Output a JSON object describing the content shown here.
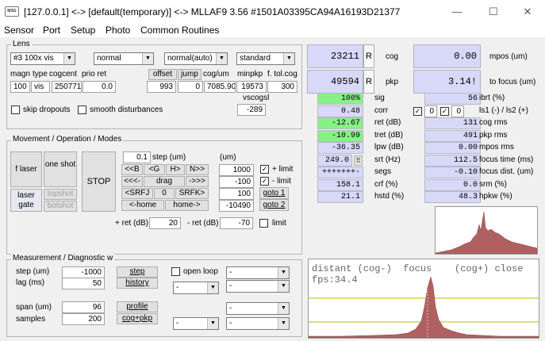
{
  "window": {
    "title": "[127.0.0.1] <-> [default(temporary)] <-> MLLAF9 3.56 #1501A03395CA94A16193D21377",
    "icon": "MSG",
    "minimize": "—",
    "maximize": "☐",
    "close": "✕"
  },
  "menu": [
    "Sensor",
    "Port",
    "Setup",
    "Photo",
    "Common Routines"
  ],
  "lens": {
    "title": "Lens",
    "lens_select": "#3 100x vis",
    "mode_select": "normal",
    "auto_select": "normal(auto)",
    "std_select": "standard",
    "hdr_magn": "magn",
    "hdr_type": "type",
    "hdr_cogcent": "cogcent",
    "hdr_prio": "prio ret",
    "magn": "100",
    "type": "vis",
    "cogcent": "250771",
    "prio": "0.0",
    "offset_btn": "offset",
    "jump_btn": "jump",
    "hdr_coguim": "cog/um",
    "hdr_minpkp": "minpkp",
    "hdr_ftol": "f. tol.cog",
    "offset": "993",
    "jump": "0",
    "coguim": "7085.90",
    "minpkp": "19573",
    "ftol": "300",
    "vscogsl_label": "vscogsl",
    "vscogsl": "-289",
    "skip_dropouts": "skip dropouts",
    "smooth": "smooth disturbances"
  },
  "movement": {
    "title": "Movement / Operation / Modes",
    "laser_btn": "f laser",
    "oneshot_btn": "one shot",
    "laser_gate_btn": "laser gate",
    "topshot_btn": "topshot",
    "botshot_btn": "botshot",
    "stop_btn": "STOP",
    "step_value": "0.1",
    "step_label": "step (um)",
    "um_label": "(um)",
    "b1": "<<B",
    "b2": "<G",
    "b3": "H>",
    "b4": "N>>",
    "b5": "<<<-",
    "b6": "drag",
    "b7": "->>>",
    "b8": "<SRFJ",
    "b9": "0",
    "b10": "SRFK>",
    "b11": "<-home",
    "b12": "home->",
    "plus_limit_val": "1000",
    "plus_limit": "+ limit",
    "minus_limit_val": "-100",
    "minus_limit": "- limit",
    "goto1_val": "100",
    "goto1": "goto 1",
    "goto2_val": "-10490",
    "goto2": "goto 2",
    "pret_label": "+ ret (dB)",
    "pret": "20",
    "mret_label": "- ret (dB)",
    "mret": "-70",
    "limit": "limit"
  },
  "measurement": {
    "title": "Measurement / Diagnostic w",
    "step_label": "step (um)",
    "step": "-1000",
    "lag_label": "lag (ms)",
    "lag": "50",
    "span_label": "span (um)",
    "span": "96",
    "samples_label": "samples",
    "samples": "200",
    "step_btn": "step",
    "history_btn": "history",
    "profile_btn": "profile",
    "cogpkp_btn": "cog+pkp",
    "openloop": "open loop",
    "combo_dash": "-"
  },
  "readout": {
    "cog": "23211",
    "cog_label": "cog",
    "mpos": "0.00",
    "mpos_label": "mpos (um)",
    "pkp": "49594",
    "pkp_label": "pkp",
    "tofocus": "3.14!",
    "tofocus_label": "to focus (um)",
    "r": "R",
    "rows": [
      {
        "v": "100%",
        "l": "sig",
        "v2": "56",
        "l2": "ibrt (%)",
        "c": "grn"
      },
      {
        "v": "0.48",
        "l": "corr",
        "v2": "",
        "l2": "ls1 (-) / ls2 (+)",
        "c": "lav"
      },
      {
        "v": "-12.67",
        "l": "ret (dB)",
        "v2": "131",
        "l2": "cog rms",
        "c": "grn"
      },
      {
        "v": "-10.99",
        "l": "tret (dB)",
        "v2": "491",
        "l2": "pkp rms",
        "c": "grn"
      },
      {
        "v": "-36.35",
        "l": "lpw (dB)",
        "v2": "0.00",
        "l2": "mpos rms",
        "c": "lav"
      },
      {
        "v": "249.0",
        "l": "srt (Hz)",
        "v2": "112.5",
        "l2": "focus time (ms)",
        "c": "lav"
      },
      {
        "v": "+++++++-",
        "l": "segs",
        "v2": "-0.10",
        "l2": "focus dist. (um)",
        "c": "lav"
      },
      {
        "v": "158.1",
        "l": "crf (%)",
        "v2": "0.0",
        "l2": "srm (%)",
        "c": "lav"
      },
      {
        "v": "21.1",
        "l": "hstd (%)",
        "v2": "48.3",
        "l2": "hpkw (%)",
        "c": "lav"
      }
    ],
    "corr_a": "0",
    "corr_b": "0",
    "srt_btn": "⠿"
  },
  "focusplot": {
    "text": "distant (cog-)  focus    (cog+) close",
    "fps": "fps:34.4"
  },
  "colors": {
    "plot_fill": "#b06060",
    "lav": "#d8d8f8",
    "green": "#88f088",
    "threshold": "#c8b400"
  }
}
